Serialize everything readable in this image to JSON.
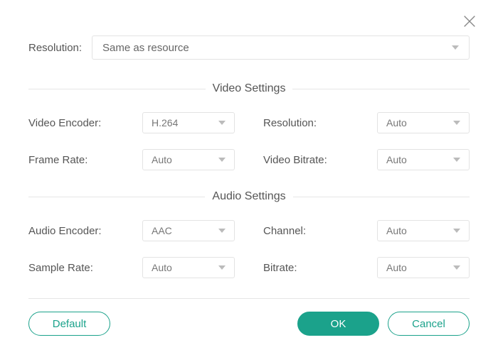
{
  "close_icon": "close",
  "top": {
    "resolution_label": "Resolution:",
    "resolution_value": "Same as resource"
  },
  "video": {
    "section_title": "Video Settings",
    "encoder_label": "Video Encoder:",
    "encoder_value": "H.264",
    "resolution_label": "Resolution:",
    "resolution_value": "Auto",
    "framerate_label": "Frame Rate:",
    "framerate_value": "Auto",
    "bitrate_label": "Video Bitrate:",
    "bitrate_value": "Auto"
  },
  "audio": {
    "section_title": "Audio Settings",
    "encoder_label": "Audio Encoder:",
    "encoder_value": "AAC",
    "channel_label": "Channel:",
    "channel_value": "Auto",
    "samplerate_label": "Sample Rate:",
    "samplerate_value": "Auto",
    "bitrate_label": "Bitrate:",
    "bitrate_value": "Auto"
  },
  "buttons": {
    "default": "Default",
    "ok": "OK",
    "cancel": "Cancel"
  }
}
